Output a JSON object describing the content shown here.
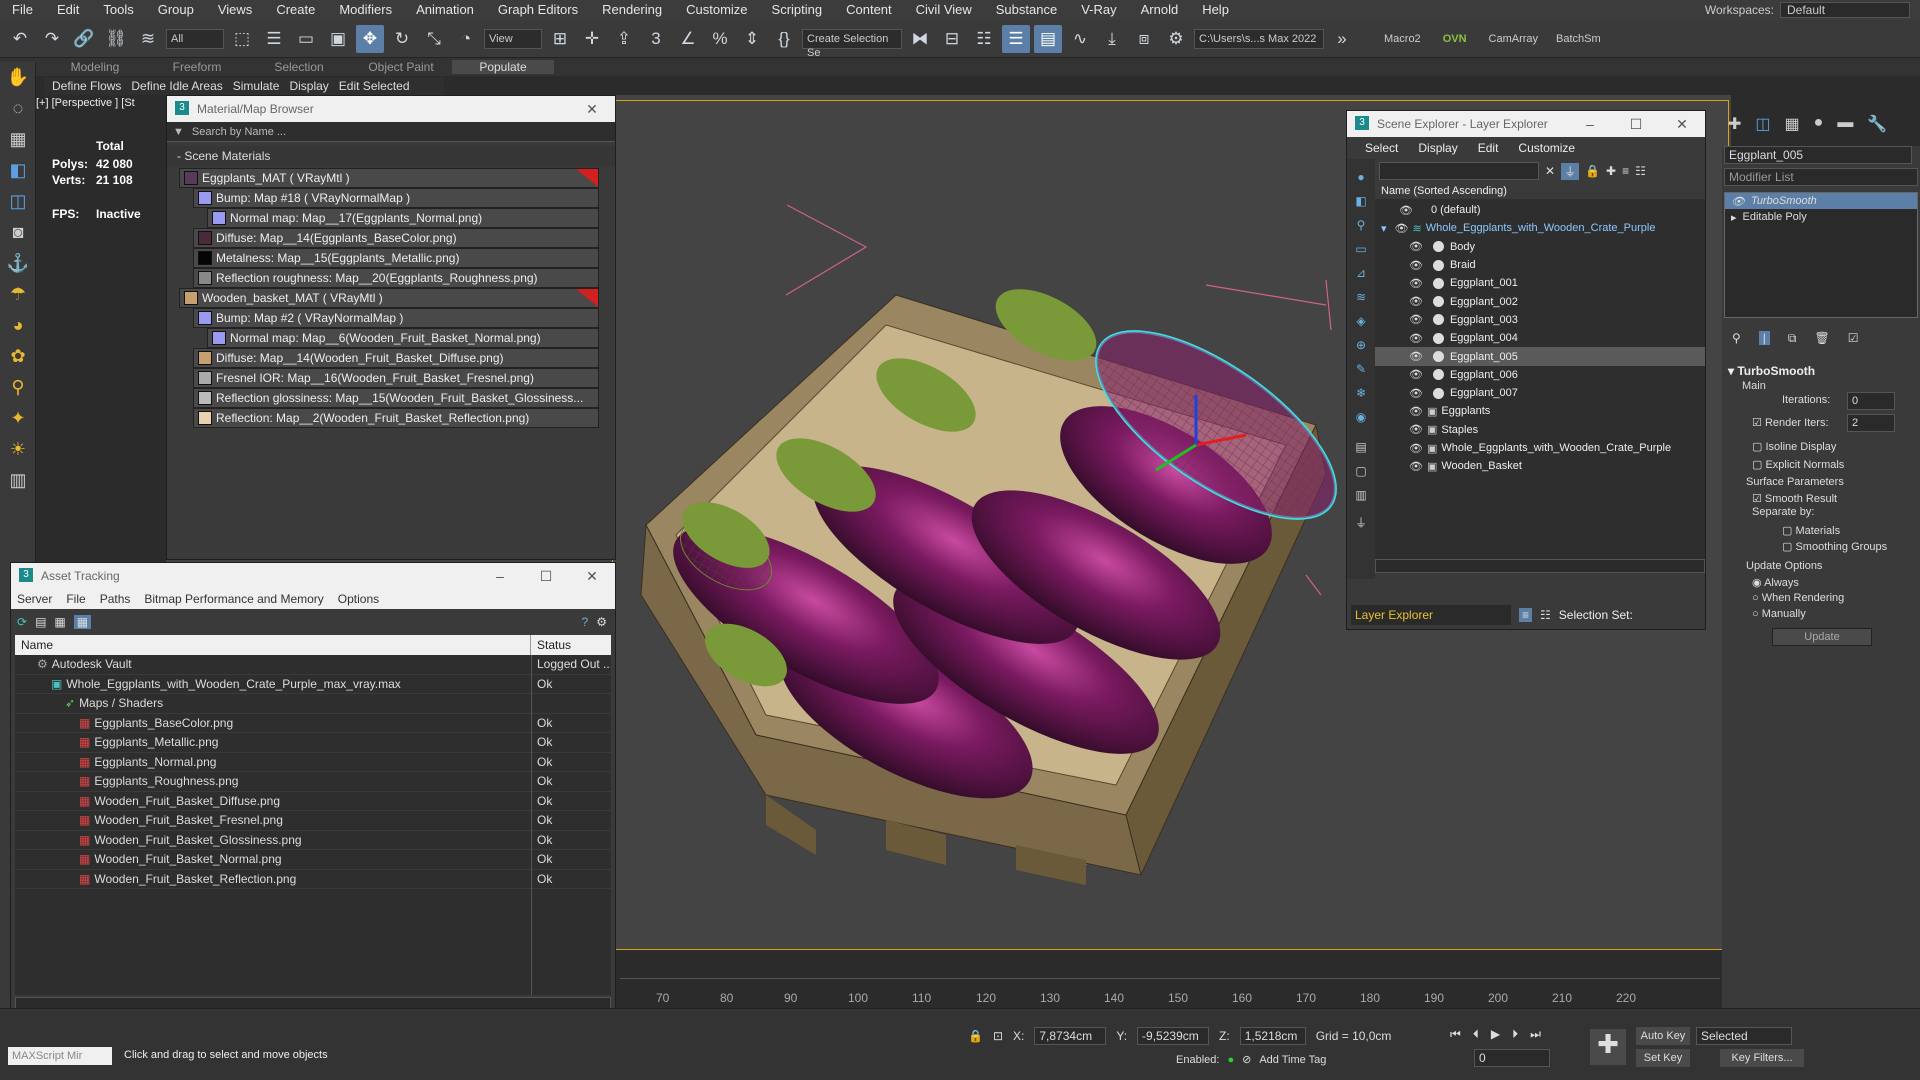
{
  "menu": [
    "File",
    "Edit",
    "Tools",
    "Group",
    "Views",
    "Create",
    "Modifiers",
    "Animation",
    "Graph Editors",
    "Rendering",
    "Customize",
    "Scripting",
    "Content",
    "Civil View",
    "Substance",
    "V-Ray",
    "Arnold",
    "Help"
  ],
  "workspaces": {
    "label": "Workspaces:",
    "value": "Default"
  },
  "toolbar": {
    "filter": "All",
    "view": "View",
    "selset": "Create Selection Se",
    "path": "C:\\Users\\s...s Max 2022",
    "macro": "Macro2",
    "ovn": "OVN",
    "camarray": "CamArray",
    "batch": "BatchSm"
  },
  "ribbon": {
    "tabs": [
      "Modeling",
      "Freeform",
      "Selection",
      "Object Paint",
      "Populate"
    ],
    "sub": [
      "Define Flows",
      "Define Idle Areas",
      "Simulate",
      "Display",
      "Edit Selected"
    ]
  },
  "viewport": {
    "label": "[+] [Perspective ] [St",
    "stats": {
      "total": "Total",
      "polys_label": "Polys:",
      "polys": "42 080",
      "verts_label": "Verts:",
      "verts": "21 108",
      "fps_label": "FPS:",
      "fps": "Inactive"
    }
  },
  "matbrowser": {
    "title": "Material/Map Browser",
    "search": "Search by Name ...",
    "section": "- Scene Materials",
    "rows": [
      {
        "t": "Eggplants_MAT  ( VRayMtl )",
        "lvl": 0,
        "sw": "#5a3a5a",
        "red": true
      },
      {
        "t": "Bump: Map #18  ( VRayNormalMap )",
        "lvl": 1,
        "sw": "#9a9af0"
      },
      {
        "t": "Normal map: Map__17(Eggplants_Normal.png)",
        "lvl": 2,
        "sw": "#9a9af0"
      },
      {
        "t": "Diffuse: Map__14(Eggplants_BaseColor.png)",
        "lvl": 1,
        "sw": "#4a2a3a"
      },
      {
        "t": "Metalness: Map__15(Eggplants_Metallic.png)",
        "lvl": 1,
        "sw": "#050505"
      },
      {
        "t": "Reflection roughness: Map__20(Eggplants_Roughness.png)",
        "lvl": 1,
        "sw": "#888"
      },
      {
        "t": "Wooden_basket_MAT  ( VRayMtl )",
        "lvl": 0,
        "sw": "#c8a070",
        "red": true
      },
      {
        "t": "Bump: Map #2  ( VRayNormalMap )",
        "lvl": 1,
        "sw": "#9a9af0"
      },
      {
        "t": "Normal map: Map__6(Wooden_Fruit_Basket_Normal.png)",
        "lvl": 2,
        "sw": "#9a9af0"
      },
      {
        "t": "Diffuse: Map__14(Wooden_Fruit_Basket_Diffuse.png)",
        "lvl": 1,
        "sw": "#c8a070"
      },
      {
        "t": "Fresnel IOR: Map__16(Wooden_Fruit_Basket_Fresnel.png)",
        "lvl": 1,
        "sw": "#aaa"
      },
      {
        "t": "Reflection glossiness: Map__15(Wooden_Fruit_Basket_Glossiness...",
        "lvl": 1,
        "sw": "#bbb"
      },
      {
        "t": "Reflection: Map__2(Wooden_Fruit_Basket_Reflection.png)",
        "lvl": 1,
        "sw": "#e8d0b0"
      }
    ]
  },
  "asset": {
    "title": "Asset Tracking",
    "menu": [
      "Server",
      "File",
      "Paths",
      "Bitmap Performance and Memory",
      "Options"
    ],
    "col_name": "Name",
    "col_status": "Status",
    "rows": [
      {
        "n": "Autodesk Vault",
        "s": "Logged Out ...",
        "lvl": 0
      },
      {
        "n": "Whole_Eggplants_with_Wooden_Crate_Purple_max_vray.max",
        "s": "Ok",
        "lvl": 1
      },
      {
        "n": "Maps / Shaders",
        "s": "",
        "lvl": 2
      },
      {
        "n": "Eggplants_BaseColor.png",
        "s": "Ok",
        "lvl": 3
      },
      {
        "n": "Eggplants_Metallic.png",
        "s": "Ok",
        "lvl": 3
      },
      {
        "n": "Eggplants_Normal.png",
        "s": "Ok",
        "lvl": 3
      },
      {
        "n": "Eggplants_Roughness.png",
        "s": "Ok",
        "lvl": 3
      },
      {
        "n": "Wooden_Fruit_Basket_Diffuse.png",
        "s": "Ok",
        "lvl": 3
      },
      {
        "n": "Wooden_Fruit_Basket_Fresnel.png",
        "s": "Ok",
        "lvl": 3
      },
      {
        "n": "Wooden_Fruit_Basket_Glossiness.png",
        "s": "Ok",
        "lvl": 3
      },
      {
        "n": "Wooden_Fruit_Basket_Normal.png",
        "s": "Ok",
        "lvl": 3
      },
      {
        "n": "Wooden_Fruit_Basket_Reflection.png",
        "s": "Ok",
        "lvl": 3
      }
    ]
  },
  "scene": {
    "title": "Scene Explorer - Layer Explorer",
    "menu": [
      "Select",
      "Display",
      "Edit",
      "Customize"
    ],
    "header": "Name (Sorted Ascending)",
    "rows": [
      {
        "n": "0 (default)",
        "lvl": 0
      },
      {
        "n": "Whole_Eggplants_with_Wooden_Crate_Purple",
        "lvl": 0,
        "layer": true
      },
      {
        "n": "Body",
        "lvl": 1
      },
      {
        "n": "Braid",
        "lvl": 1
      },
      {
        "n": "Eggplant_001",
        "lvl": 1
      },
      {
        "n": "Eggplant_002",
        "lvl": 1
      },
      {
        "n": "Eggplant_003",
        "lvl": 1
      },
      {
        "n": "Eggplant_004",
        "lvl": 1
      },
      {
        "n": "Eggplant_005",
        "lvl": 1,
        "sel": true
      },
      {
        "n": "Eggplant_006",
        "lvl": 1
      },
      {
        "n": "Eggplant_007",
        "lvl": 1
      },
      {
        "n": "Eggplants",
        "lvl": 1
      },
      {
        "n": "Staples",
        "lvl": 1
      },
      {
        "n": "Whole_Eggplants_with_Wooden_Crate_Purple",
        "lvl": 1
      },
      {
        "n": "Wooden_Basket",
        "lvl": 1
      }
    ],
    "footer": "Layer Explorer",
    "selset": "Selection Set:"
  },
  "modify": {
    "objname": "Eggplant_005",
    "modlist": "Modifier List",
    "stack": [
      "TurboSmooth",
      "Editable Poly"
    ],
    "ts": {
      "title": "TurboSmooth",
      "main": "Main",
      "iter_l": "Iterations:",
      "iter": "0",
      "render_l": "Render Iters:",
      "render": "2",
      "isoline": "Isoline Display",
      "explicit": "Explicit Normals",
      "surface": "Surface Parameters",
      "smooth": "Smooth Result",
      "separate": "Separate by:",
      "materials": "Materials",
      "groups": "Smoothing Groups",
      "update": "Update Options",
      "always": "Always",
      "rendering": "When Rendering",
      "manually": "Manually",
      "updbtn": "Update"
    }
  },
  "status": {
    "maxscript": "MAXScript Mir",
    "hint": "Click and drag to select and move objects",
    "x_l": "X:",
    "x": "7,8734cm",
    "y_l": "Y:",
    "y": "-9,5239cm",
    "z_l": "Z:",
    "z": "1,5218cm",
    "grid": "Grid = 10,0cm",
    "enabled": "Enabled:",
    "addtime": "Add Time Tag",
    "autokey": "Auto Key",
    "selected": "Selected",
    "setkey": "Set Key",
    "keyfilters": "Key Filters...",
    "frame": "0"
  },
  "ruler": [
    "70",
    "80",
    "90",
    "100",
    "110",
    "120",
    "130",
    "140",
    "150",
    "160",
    "170",
    "180",
    "190",
    "200",
    "210",
    "220"
  ]
}
